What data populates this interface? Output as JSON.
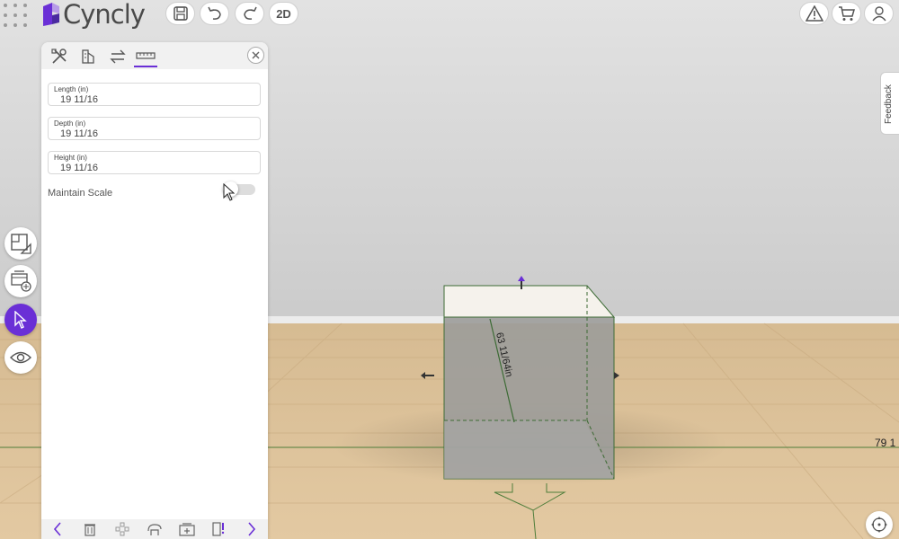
{
  "app": {
    "brand": "Cyncly",
    "view_mode_label": "2D"
  },
  "panel": {
    "fields": [
      {
        "label": "Length (in)",
        "value": "19 11/16"
      },
      {
        "label": "Depth (in)",
        "value": "19 11/16"
      },
      {
        "label": "Height (in)",
        "value": "19 11/16"
      }
    ],
    "maintain_scale_label": "Maintain Scale"
  },
  "feedback_label": "Feedback",
  "scene": {
    "diagonal_dimension": "63 11/64in",
    "side_dimension": "79 1"
  },
  "colors": {
    "accent": "#6a2fd6",
    "floor_line": "#4e7d3a",
    "box_edge": "#3d6b35"
  }
}
